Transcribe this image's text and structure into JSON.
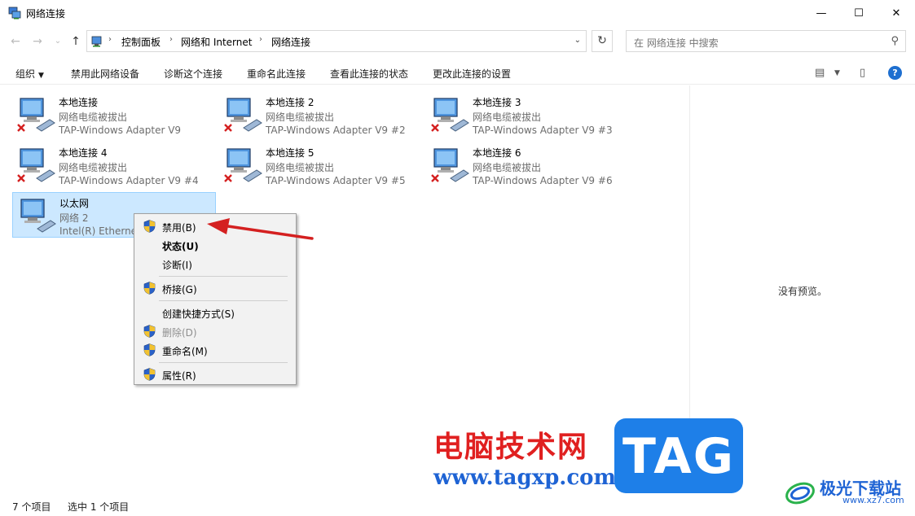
{
  "window": {
    "title": "网络连接",
    "controls": {
      "minimize": "—",
      "maximize": "☐",
      "close": "✕"
    }
  },
  "nav": {
    "back_icon": "←",
    "forward_icon": "→",
    "recent_icon": "⌄",
    "up_icon": "↑",
    "refresh_icon": "↻",
    "breadcrumbs": [
      "控制面板",
      "网络和 Internet",
      "网络连接"
    ],
    "breadcrumb_sep": "›",
    "search_placeholder": "在 网络连接 中搜索",
    "search_icon": "⚲"
  },
  "commands": {
    "organize": "组织",
    "disable_device": "禁用此网络设备",
    "diagnose": "诊断这个连接",
    "rename": "重命名此连接",
    "view_status": "查看此连接的状态",
    "change_settings": "更改此连接的设置",
    "help": "?"
  },
  "connections": [
    {
      "name": "本地连接",
      "status": "网络电缆被拔出",
      "device": "TAP-Windows Adapter V9",
      "disconnected": true
    },
    {
      "name": "本地连接 2",
      "status": "网络电缆被拔出",
      "device": "TAP-Windows Adapter V9 #2",
      "disconnected": true
    },
    {
      "name": "本地连接 3",
      "status": "网络电缆被拔出",
      "device": "TAP-Windows Adapter V9 #3",
      "disconnected": true
    },
    {
      "name": "本地连接 4",
      "status": "网络电缆被拔出",
      "device": "TAP-Windows Adapter V9 #4",
      "disconnected": true
    },
    {
      "name": "本地连接 5",
      "status": "网络电缆被拔出",
      "device": "TAP-Windows Adapter V9 #5",
      "disconnected": true
    },
    {
      "name": "本地连接 6",
      "status": "网络电缆被拔出",
      "device": "TAP-Windows Adapter V9 #6",
      "disconnected": true
    },
    {
      "name": "以太网",
      "status": "网络 2",
      "device": "Intel(R) Ethernet",
      "disconnected": false,
      "selected": true
    }
  ],
  "context_menu": [
    {
      "label": "禁用(B)",
      "shield": true
    },
    {
      "label": "状态(U)",
      "bold": true
    },
    {
      "label": "诊断(I)"
    },
    {
      "label": "桥接(G)",
      "shield": true
    },
    {
      "label": "创建快捷方式(S)"
    },
    {
      "label": "删除(D)",
      "shield": true,
      "disabled": true
    },
    {
      "label": "重命名(M)",
      "shield": true
    },
    {
      "label": "属性(R)",
      "shield": true
    }
  ],
  "preview": {
    "message": "没有预览。"
  },
  "statusbar": {
    "count": "7 个项目",
    "selected": "选中 1 个项目"
  },
  "watermark": {
    "title": "电脑技术网",
    "url": "www.tagxp.com",
    "tag": "TAG",
    "site_name": "极光下载站",
    "site_url": "www.xz7.com"
  },
  "colors": {
    "accent": "#1e6fd0",
    "selection": "#cce8ff",
    "arrow": "#d42020"
  }
}
